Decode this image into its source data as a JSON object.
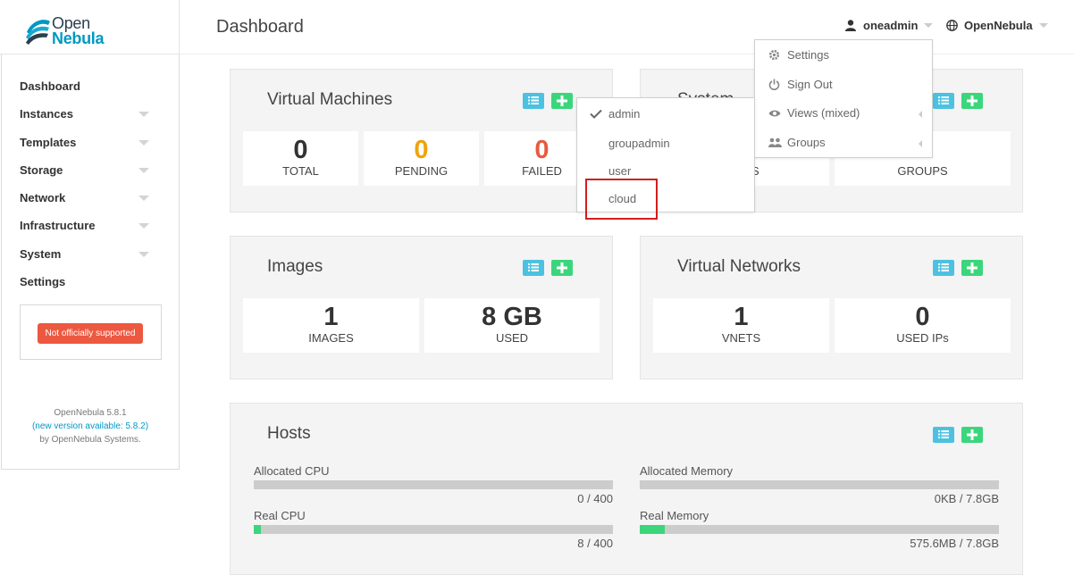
{
  "brand": {
    "line1": "Open",
    "line2": "Nebula"
  },
  "sidebar": {
    "items": [
      {
        "label": "Dashboard",
        "has_caret": false
      },
      {
        "label": "Instances",
        "has_caret": true
      },
      {
        "label": "Templates",
        "has_caret": true
      },
      {
        "label": "Storage",
        "has_caret": true
      },
      {
        "label": "Network",
        "has_caret": true
      },
      {
        "label": "Infrastructure",
        "has_caret": true
      },
      {
        "label": "System",
        "has_caret": true
      },
      {
        "label": "Settings",
        "has_caret": false
      }
    ],
    "support_badge": "Not officially supported",
    "version": "OpenNebula 5.8.1",
    "new_version": "(new version available: 5.8.2)",
    "by_prefix": "by",
    "by_company": "OpenNebula Systems."
  },
  "header": {
    "title": "Dashboard",
    "user": "oneadmin",
    "zone": "OpenNebula"
  },
  "user_menu": {
    "items": [
      {
        "label": "Settings",
        "icon": "gear-icon"
      },
      {
        "label": "Sign Out",
        "icon": "power-icon"
      },
      {
        "label": "Views (mixed)",
        "icon": "eye-icon"
      },
      {
        "label": "Groups",
        "icon": "users-icon"
      }
    ]
  },
  "views_submenu": {
    "items": [
      "admin",
      "groupadmin",
      "user",
      "cloud"
    ],
    "checked": "admin"
  },
  "panels": {
    "vms": {
      "title": "Virtual Machines",
      "stats": [
        {
          "value": "0",
          "label": "TOTAL",
          "color": "#333333"
        },
        {
          "value": "0",
          "label": "PENDING",
          "color": "#f0a30a"
        },
        {
          "value": "0",
          "label": "FAILED",
          "color": "#e85a3f"
        }
      ]
    },
    "system": {
      "title": "System",
      "stat1_label": "S",
      "stat2_label": "GROUPS"
    },
    "images": {
      "title": "Images",
      "stats": [
        {
          "value": "1",
          "label": "IMAGES"
        },
        {
          "value": "8 GB",
          "label": "USED"
        }
      ]
    },
    "vnets": {
      "title": "Virtual Networks",
      "stats": [
        {
          "value": "1",
          "label": "VNETS"
        },
        {
          "value": "0",
          "label": "USED IPs"
        }
      ]
    },
    "hosts": {
      "title": "Hosts",
      "alloc_cpu": {
        "label": "Allocated CPU",
        "value": "0 / 400",
        "fraction": 0.0
      },
      "real_cpu": {
        "label": "Real CPU",
        "value": "8 / 400",
        "fraction": 0.02
      },
      "alloc_mem": {
        "label": "Allocated Memory",
        "value": "0KB / 7.8GB",
        "fraction": 0.0
      },
      "real_mem": {
        "label": "Real Memory",
        "value": "575.6MB / 7.8GB",
        "fraction": 0.07
      }
    }
  },
  "colors": {
    "accent": "#0098c3",
    "list_button": "#4dc1e0",
    "add_button": "#3bd67c",
    "badge_red": "#ec5840",
    "highlight_red": "#d21e1e"
  }
}
